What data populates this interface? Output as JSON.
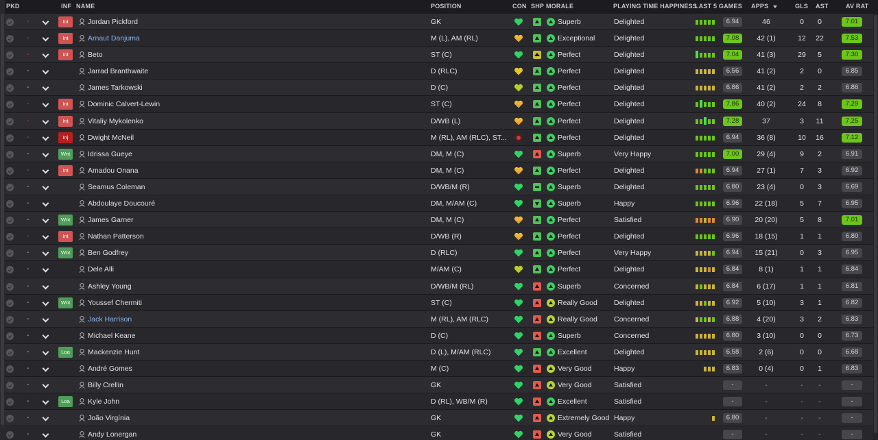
{
  "headers": {
    "pkd": "PKD",
    "inf": "INF",
    "name": "NAME",
    "position": "POSITION",
    "con": "CON",
    "shp": "SHP",
    "morale": "MORALE",
    "happiness": "PLAYING TIME HAPPINESS",
    "last5": "LAST 5 GAMES",
    "apps": "APPS",
    "gls": "GLS",
    "ast": "AST",
    "avrat": "AV RAT"
  },
  "colors": {
    "green": "#6cc51a",
    "orange": "#e0892b",
    "yellow": "#d9c22a",
    "red": "#e8504a",
    "heart_green": "#46d46a"
  },
  "players": [
    {
      "pkd": "-",
      "pkd_color": "red",
      "inf": "Int",
      "inf_type": "int",
      "name": "Jordan Pickford",
      "link": false,
      "position": "GK",
      "con": "heart-green",
      "shp": "green",
      "morale": "Superb",
      "happiness": "Delighted",
      "last5": [
        "g",
        "g",
        "g",
        "g",
        "g"
      ],
      "last5_rating": "6.94",
      "last5_hi": false,
      "apps": "46",
      "gls": "0",
      "ast": "0",
      "av": "7.01",
      "av_hi": true
    },
    {
      "pkd": "-",
      "pkd_color": "red",
      "inf": "Int",
      "inf_type": "int",
      "name": "Arnaut Danjuma",
      "link": true,
      "position": "M (L), AM (RL)",
      "con": "heart-orange",
      "shp": "green",
      "morale": "Exceptional",
      "happiness": "Delighted",
      "last5": [
        "g",
        "g",
        "g",
        "g",
        "g"
      ],
      "last5_rating": "7.08",
      "last5_hi": true,
      "apps": "42 (1)",
      "gls": "12",
      "ast": "22",
      "av": "7.53",
      "av_hi": true
    },
    {
      "pkd": "-",
      "pkd_color": "red",
      "inf": "Int",
      "inf_type": "int",
      "name": "Beto",
      "link": false,
      "position": "ST (C)",
      "con": "heart-green",
      "shp": "yellow",
      "morale": "Perfect",
      "happiness": "Delighted",
      "last5": [
        "G",
        "g",
        "g",
        "g",
        "g"
      ],
      "last5_rating": "7.04",
      "last5_hi": true,
      "apps": "41 (3)",
      "gls": "29",
      "ast": "5",
      "av": "7.30",
      "av_hi": true
    },
    {
      "pkd": "-",
      "pkd_color": "grey",
      "inf": "",
      "inf_type": "",
      "name": "Jarrad Branthwaite",
      "link": false,
      "position": "D (RLC)",
      "con": "heart-yellow",
      "shp": "green",
      "morale": "Perfect",
      "happiness": "Delighted",
      "last5": [
        "y",
        "y",
        "y",
        "y",
        "y"
      ],
      "last5_rating": "6.56",
      "last5_hi": false,
      "apps": "41 (2)",
      "gls": "2",
      "ast": "0",
      "av": "6.85",
      "av_hi": false
    },
    {
      "pkd": "-",
      "pkd_color": "grey",
      "inf": "",
      "inf_type": "",
      "name": "James Tarkowski",
      "link": false,
      "position": "D (C)",
      "con": "heart-yellowgreen",
      "shp": "green",
      "morale": "Perfect",
      "happiness": "Delighted",
      "last5": [
        "y",
        "y",
        "y",
        "y",
        "y"
      ],
      "last5_rating": "6.86",
      "last5_hi": false,
      "apps": "41 (2)",
      "gls": "2",
      "ast": "2",
      "av": "6.86",
      "av_hi": false
    },
    {
      "pkd": "-",
      "pkd_color": "red",
      "inf": "Int",
      "inf_type": "int",
      "name": "Dominic Calvert-Lewin",
      "link": false,
      "position": "ST (C)",
      "con": "heart-orange",
      "shp": "green",
      "morale": "Perfect",
      "happiness": "Delighted",
      "last5": [
        "g",
        "G",
        "g",
        "g",
        "g"
      ],
      "last5_rating": "7.86",
      "last5_hi": true,
      "apps": "40 (2)",
      "gls": "24",
      "ast": "8",
      "av": "7.29",
      "av_hi": true
    },
    {
      "pkd": "-",
      "pkd_color": "red",
      "inf": "Int",
      "inf_type": "int",
      "name": "Vitaliy Mykolenko",
      "link": false,
      "position": "D/WB (L)",
      "con": "heart-orange",
      "shp": "green",
      "morale": "Perfect",
      "happiness": "Delighted",
      "last5": [
        "g",
        "g",
        "G",
        "g",
        "g"
      ],
      "last5_rating": "7.28",
      "last5_hi": true,
      "apps": "37",
      "gls": "3",
      "ast": "11",
      "av": "7.25",
      "av_hi": true
    },
    {
      "pkd": "-",
      "pkd_color": "red",
      "inf": "Inj",
      "inf_type": "inj",
      "name": "Dwight McNeil",
      "link": false,
      "position": "M (RL), AM (RLC), ST...",
      "con": "injury",
      "shp": "green",
      "morale": "Perfect",
      "happiness": "Delighted",
      "last5": [
        "g",
        "g",
        "g",
        "g",
        "g"
      ],
      "last5_rating": "6.94",
      "last5_hi": false,
      "apps": "36 (8)",
      "gls": "10",
      "ast": "16",
      "av": "7.12",
      "av_hi": true
    },
    {
      "pkd": "-",
      "pkd_color": "grey",
      "inf": "Wnt",
      "inf_type": "wnt",
      "name": "Idrissa Gueye",
      "link": false,
      "position": "DM, M (C)",
      "con": "heart-green",
      "shp": "red",
      "morale": "Superb",
      "happiness": "Very Happy",
      "last5": [
        "g",
        "g",
        "g",
        "g",
        "g"
      ],
      "last5_rating": "7.00",
      "last5_hi": true,
      "apps": "29 (4)",
      "gls": "9",
      "ast": "2",
      "av": "6.91",
      "av_hi": false
    },
    {
      "pkd": "-",
      "pkd_color": "red",
      "inf": "Int",
      "inf_type": "int",
      "name": "Amadou Onana",
      "link": false,
      "position": "DM, M (C)",
      "con": "heart-orange",
      "shp": "green",
      "morale": "Perfect",
      "happiness": "Delighted",
      "last5": [
        "o",
        "o",
        "g",
        "g",
        "g"
      ],
      "last5_rating": "6.94",
      "last5_hi": false,
      "apps": "27 (1)",
      "gls": "7",
      "ast": "3",
      "av": "6.92",
      "av_hi": false
    },
    {
      "pkd": "-",
      "pkd_color": "grey",
      "inf": "",
      "inf_type": "",
      "name": "Seamus Coleman",
      "link": false,
      "position": "D/WB/M (R)",
      "con": "heart-green",
      "shp": "green-flat",
      "morale": "Superb",
      "happiness": "Delighted",
      "last5": [
        "g",
        "g",
        "g",
        "g",
        "g"
      ],
      "last5_rating": "6.80",
      "last5_hi": false,
      "apps": "23 (4)",
      "gls": "0",
      "ast": "3",
      "av": "6.69",
      "av_hi": false
    },
    {
      "pkd": "-",
      "pkd_color": "grey",
      "inf": "",
      "inf_type": "",
      "name": "Abdoulaye Doucouré",
      "link": false,
      "position": "DM, M/AM (C)",
      "con": "heart-green",
      "shp": "green-down",
      "morale": "Superb",
      "happiness": "Happy",
      "last5": [
        "g",
        "g",
        "g",
        "g",
        "g"
      ],
      "last5_rating": "6.96",
      "last5_hi": false,
      "apps": "22 (18)",
      "gls": "5",
      "ast": "7",
      "av": "6.95",
      "av_hi": false
    },
    {
      "pkd": "-",
      "pkd_color": "grey",
      "inf": "Wnt",
      "inf_type": "wnt",
      "name": "James Garner",
      "link": false,
      "position": "DM, M (C)",
      "con": "heart-orange",
      "shp": "green",
      "morale": "Perfect",
      "happiness": "Satisfied",
      "last5": [
        "o",
        "o",
        "y",
        "o",
        "o"
      ],
      "last5_rating": "6.90",
      "last5_hi": false,
      "apps": "20 (20)",
      "gls": "5",
      "ast": "8",
      "av": "7.01",
      "av_hi": true
    },
    {
      "pkd": "-",
      "pkd_color": "red",
      "inf": "Int",
      "inf_type": "int",
      "name": "Nathan Patterson",
      "link": false,
      "position": "D/WB (R)",
      "con": "heart-orange",
      "shp": "green",
      "morale": "Perfect",
      "happiness": "Delighted",
      "last5": [
        "g",
        "g",
        "g",
        "g",
        "g"
      ],
      "last5_rating": "6.96",
      "last5_hi": false,
      "apps": "18 (15)",
      "gls": "1",
      "ast": "1",
      "av": "6.80",
      "av_hi": false
    },
    {
      "pkd": "-",
      "pkd_color": "grey",
      "inf": "Wnt",
      "inf_type": "wnt",
      "name": "Ben Godfrey",
      "link": false,
      "position": "D (RLC)",
      "con": "heart-green",
      "shp": "green",
      "morale": "Perfect",
      "happiness": "Very Happy",
      "last5": [
        "y",
        "y",
        "y",
        "y",
        "g"
      ],
      "last5_rating": "6.94",
      "last5_hi": false,
      "apps": "15 (21)",
      "gls": "0",
      "ast": "3",
      "av": "6.95",
      "av_hi": false
    },
    {
      "pkd": "-",
      "pkd_color": "grey",
      "inf": "",
      "inf_type": "",
      "name": "Dele Alli",
      "link": false,
      "position": "M/AM (C)",
      "con": "heart-yellowgreen",
      "shp": "green",
      "morale": "Perfect",
      "happiness": "Delighted",
      "last5": [
        "y",
        "y",
        "y",
        "o",
        "y"
      ],
      "last5_rating": "6.84",
      "last5_hi": false,
      "apps": "8 (1)",
      "gls": "1",
      "ast": "1",
      "av": "6.84",
      "av_hi": false
    },
    {
      "pkd": "-",
      "pkd_color": "grey",
      "inf": "",
      "inf_type": "",
      "name": "Ashley Young",
      "link": false,
      "position": "D/WB/M (RL)",
      "con": "heart-green",
      "shp": "red",
      "morale": "Superb",
      "happiness": "Concerned",
      "last5": [
        "y",
        "g",
        "y",
        "y",
        "y"
      ],
      "last5_rating": "6.84",
      "last5_hi": false,
      "apps": "6 (17)",
      "gls": "1",
      "ast": "1",
      "av": "6.81",
      "av_hi": false
    },
    {
      "pkd": "-",
      "pkd_color": "grey",
      "inf": "Wnt",
      "inf_type": "wnt",
      "name": "Youssef Chermiti",
      "link": false,
      "position": "ST (C)",
      "con": "heart-green",
      "shp": "red",
      "morale": "Really Good",
      "happiness": "Delighted",
      "last5": [
        "y",
        "y",
        "g",
        "y",
        "y"
      ],
      "last5_rating": "6.92",
      "last5_hi": false,
      "apps": "5 (10)",
      "gls": "3",
      "ast": "1",
      "av": "6.82",
      "av_hi": false
    },
    {
      "pkd": "-",
      "pkd_color": "grey",
      "inf": "",
      "inf_type": "",
      "name": "Jack Harrison",
      "link": true,
      "position": "M (RL), AM (RLC)",
      "con": "heart-green",
      "shp": "red",
      "morale": "Really Good",
      "happiness": "Concerned",
      "last5": [
        "y",
        "g",
        "g",
        "y",
        "g"
      ],
      "last5_rating": "6.88",
      "last5_hi": false,
      "apps": "4 (20)",
      "gls": "3",
      "ast": "2",
      "av": "6.83",
      "av_hi": false
    },
    {
      "pkd": "-",
      "pkd_color": "grey",
      "inf": "",
      "inf_type": "",
      "name": "Michael Keane",
      "link": false,
      "position": "D (C)",
      "con": "heart-green",
      "shp": "red",
      "morale": "Superb",
      "happiness": "Concerned",
      "last5": [
        "y",
        "y",
        "y",
        "y",
        "y"
      ],
      "last5_rating": "6.80",
      "last5_hi": false,
      "apps": "3 (10)",
      "gls": "0",
      "ast": "0",
      "av": "6.73",
      "av_hi": false
    },
    {
      "pkd": "-",
      "pkd_color": "grey",
      "inf": "Loa",
      "inf_type": "loa",
      "name": "Mackenzie Hunt",
      "link": false,
      "position": "D (L), M/AM (RLC)",
      "con": "heart-green",
      "shp": "green",
      "morale": "Excellent",
      "happiness": "Delighted",
      "last5": [
        "y",
        "y",
        "y",
        "y",
        "y"
      ],
      "last5_rating": "6.58",
      "last5_hi": false,
      "apps": "2 (6)",
      "gls": "0",
      "ast": "0",
      "av": "6.68",
      "av_hi": false
    },
    {
      "pkd": "-",
      "pkd_color": "grey",
      "inf": "",
      "inf_type": "",
      "name": "André Gomes",
      "link": false,
      "position": "M (C)",
      "con": "heart-green",
      "shp": "red",
      "morale": "Very Good",
      "happiness": "Happy",
      "last5": [
        "",
        "",
        "y",
        "y",
        "y"
      ],
      "last5_rating": "6.83",
      "last5_hi": false,
      "apps": "0 (4)",
      "gls": "0",
      "ast": "1",
      "av": "6.83",
      "av_hi": false
    },
    {
      "pkd": "-",
      "pkd_color": "grey",
      "inf": "",
      "inf_type": "",
      "name": "Billy Crellin",
      "link": false,
      "position": "GK",
      "con": "heart-green",
      "shp": "red",
      "morale": "Very Good",
      "happiness": "Satisfied",
      "last5": [],
      "last5_rating": "-",
      "last5_hi": false,
      "apps": "-",
      "gls": "-",
      "ast": "-",
      "av": "-",
      "av_hi": false
    },
    {
      "pkd": "-",
      "pkd_color": "grey",
      "inf": "Loa",
      "inf_type": "loa",
      "name": "Kyle John",
      "link": false,
      "position": "D (RL), WB/M (R)",
      "con": "heart-green",
      "shp": "red",
      "morale": "Excellent",
      "happiness": "Satisfied",
      "last5": [],
      "last5_rating": "-",
      "last5_hi": false,
      "apps": "-",
      "gls": "-",
      "ast": "-",
      "av": "-",
      "av_hi": false
    },
    {
      "pkd": "-",
      "pkd_color": "grey",
      "inf": "",
      "inf_type": "",
      "name": "João Virgínia",
      "link": false,
      "position": "GK",
      "con": "heart-green",
      "shp": "red",
      "morale": "Extremely Good",
      "happiness": "Happy",
      "last5": [
        "",
        "",
        "",
        "",
        "y"
      ],
      "last5_rating": "6.80",
      "last5_hi": false,
      "apps": "-",
      "gls": "-",
      "ast": "-",
      "av": "-",
      "av_hi": false
    },
    {
      "pkd": "-",
      "pkd_color": "grey",
      "inf": "",
      "inf_type": "",
      "name": "Andy Lonergan",
      "link": false,
      "position": "GK",
      "con": "heart-green",
      "shp": "red",
      "morale": "Very Good",
      "happiness": "Satisfied",
      "last5": [],
      "last5_rating": "-",
      "last5_hi": false,
      "apps": "-",
      "gls": "-",
      "ast": "-",
      "av": "-",
      "av_hi": false
    }
  ]
}
